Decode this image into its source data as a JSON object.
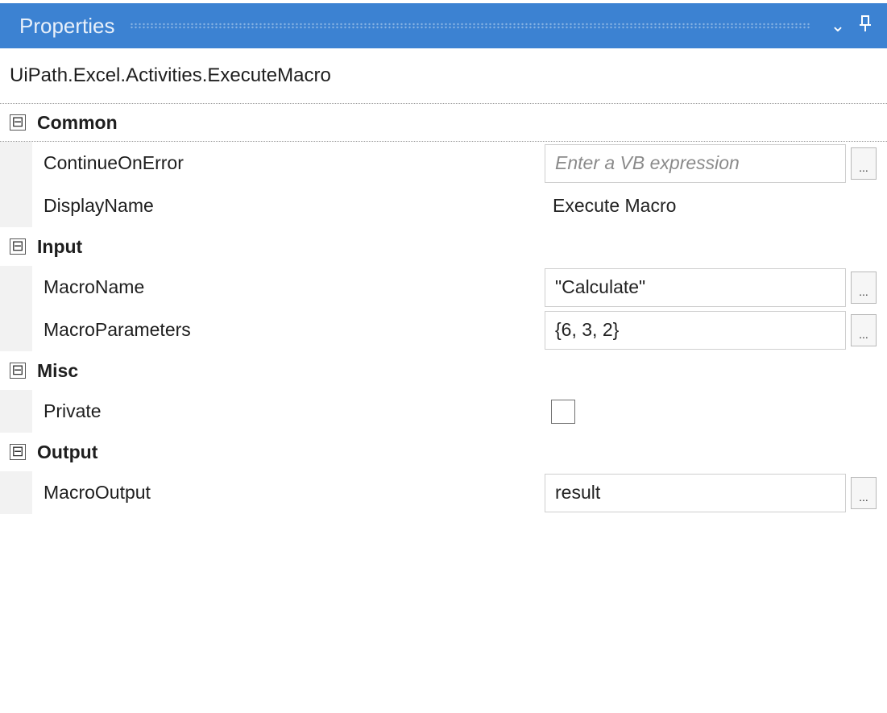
{
  "panel": {
    "title": "Properties",
    "chevron_icon": "chevron-down-icon",
    "pin_icon": "pin-icon"
  },
  "activity_type": "UiPath.Excel.Activities.ExecuteMacro",
  "categories": {
    "common": {
      "label": "Common",
      "continue_on_error": {
        "name": "ContinueOnError",
        "placeholder": "Enter a VB expression"
      },
      "display_name": {
        "name": "DisplayName",
        "value": "Execute Macro"
      }
    },
    "input": {
      "label": "Input",
      "macro_name": {
        "name": "MacroName",
        "value": "\"Calculate\""
      },
      "macro_parameters": {
        "name": "MacroParameters",
        "value": "{6, 3, 2}"
      }
    },
    "misc": {
      "label": "Misc",
      "private": {
        "name": "Private",
        "checked": false
      }
    },
    "output": {
      "label": "Output",
      "macro_output": {
        "name": "MacroOutput",
        "value": "result"
      }
    }
  },
  "ui": {
    "collapse_glyph": "⊟",
    "ellipsis_label": "...",
    "accent_color": "#3c82d2"
  }
}
